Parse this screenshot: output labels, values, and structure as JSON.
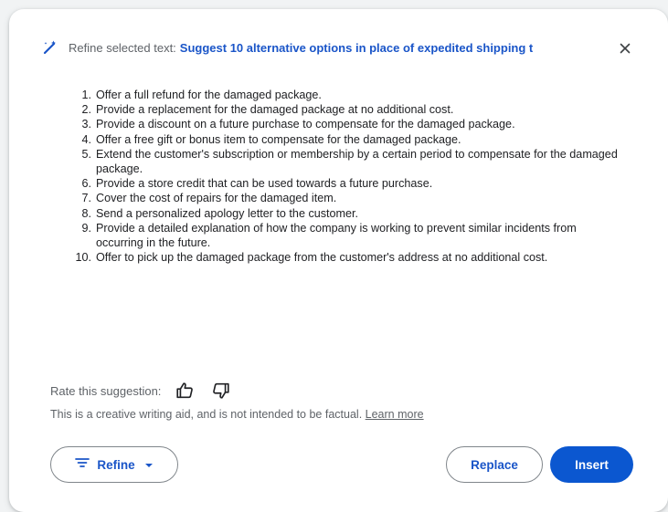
{
  "header": {
    "icon": "magic-wand-icon",
    "label": "Refine selected text:",
    "prompt": "Suggest 10 alternative options in place of expedited shipping t"
  },
  "close": {
    "icon": "close-icon"
  },
  "suggestions": [
    {
      "num": "1.",
      "text": "Offer a full refund for the damaged package."
    },
    {
      "num": "2.",
      "text": "Provide a replacement for the damaged package at no additional cost."
    },
    {
      "num": "3.",
      "text": "Provide a discount on a future purchase to compensate for the damaged package."
    },
    {
      "num": "4.",
      "text": "Offer a free gift or bonus item to compensate for the damaged package."
    },
    {
      "num": "5.",
      "text": "Extend the customer's subscription or membership by a certain period to compensate for the damaged package."
    },
    {
      "num": "6.",
      "text": "Provide a store credit that can be used towards a future purchase."
    },
    {
      "num": "7.",
      "text": "Cover the cost of repairs for the damaged item."
    },
    {
      "num": "8.",
      "text": "Send a personalized apology letter to the customer."
    },
    {
      "num": "9.",
      "text": "Provide a detailed explanation of how the company is working to prevent similar incidents from occurring in the future."
    },
    {
      "num": "10.",
      "text": "Offer to pick up the damaged package from the customer's address at no additional cost."
    }
  ],
  "rating": {
    "label": "Rate this suggestion:",
    "thumbs_up_icon": "thumbs-up-icon",
    "thumbs_down_icon": "thumbs-down-icon"
  },
  "disclaimer": {
    "text": "This is a creative writing aid, and is not intended to be factual.",
    "link": "Learn more"
  },
  "actions": {
    "refine_label": "Refine",
    "refine_icon": "filter-lines-icon",
    "refine_dropdown_icon": "caret-down-icon",
    "replace_label": "Replace",
    "insert_label": "Insert"
  },
  "colors": {
    "accent": "#1a55c8",
    "primary_button": "#0b57d0",
    "secondary_text": "#5f6368"
  }
}
